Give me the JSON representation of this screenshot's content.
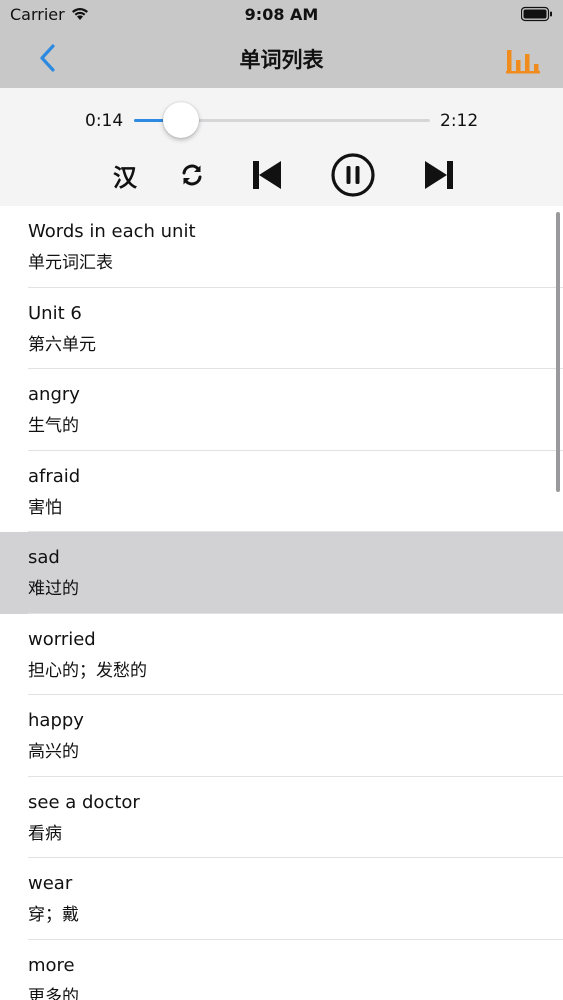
{
  "status_bar": {
    "carrier": "Carrier",
    "time": "9:08 AM"
  },
  "nav": {
    "title": "单词列表",
    "back_icon": "chevron-left-icon",
    "right_icon": "equalizer-icon",
    "accent_color": "#2d8ae0",
    "equalizer_color": "#f08c1e"
  },
  "player": {
    "current_time": "0:14",
    "total_time": "2:12",
    "progress": 0.16,
    "chinese_toggle_label": "汉",
    "repeat_icon": "repeat-icon",
    "prev_icon": "skip-back-icon",
    "pause_icon": "pause-icon",
    "next_icon": "skip-forward-icon"
  },
  "words": [
    {
      "en": "Words in each unit",
      "zh": "单元词汇表",
      "selected": false
    },
    {
      "en": "Unit 6",
      "zh": "第六单元",
      "selected": false
    },
    {
      "en": "angry",
      "zh": "生气的",
      "selected": false
    },
    {
      "en": "afraid",
      "zh": "害怕",
      "selected": false
    },
    {
      "en": "sad",
      "zh": "难过的",
      "selected": true
    },
    {
      "en": "worried",
      "zh": "担心的；发愁的",
      "selected": false
    },
    {
      "en": "happy",
      "zh": "高兴的",
      "selected": false
    },
    {
      "en": "see a doctor",
      "zh": "看病",
      "selected": false
    },
    {
      "en": "wear",
      "zh": "穿；戴",
      "selected": false
    },
    {
      "en": "more",
      "zh": "更多的",
      "selected": false
    }
  ]
}
